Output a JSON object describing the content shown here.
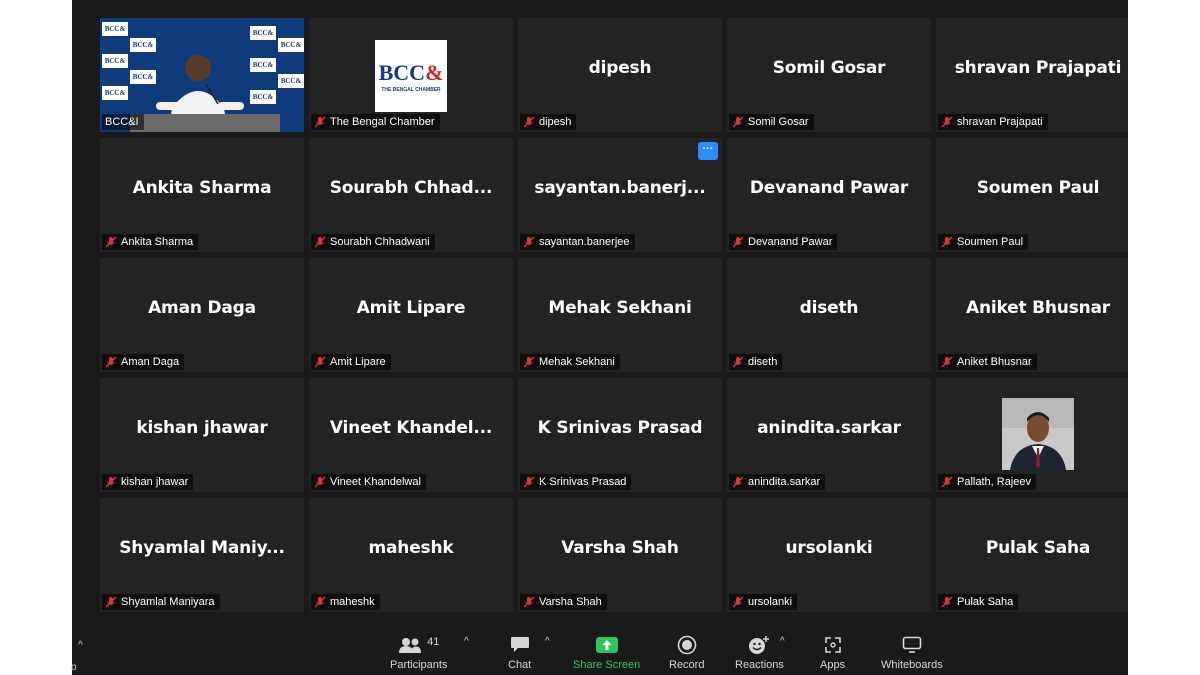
{
  "tiles": [
    {
      "display": "",
      "nameplate": "BCC&I",
      "type": "video"
    },
    {
      "display": "",
      "nameplate": "The Bengal Chamber",
      "type": "logo"
    },
    {
      "display": "dipesh",
      "nameplate": "dipesh"
    },
    {
      "display": "Somil Gosar",
      "nameplate": "Somil Gosar"
    },
    {
      "display": "shravan Prajapati",
      "nameplate": "shravan Prajapati"
    },
    {
      "display": "Ankita Sharma",
      "nameplate": "Ankita Sharma"
    },
    {
      "display": "Sourabh Chhad...",
      "nameplate": "Sourabh Chhadwani"
    },
    {
      "display": "sayantan.banerj...",
      "nameplate": "sayantan.banerjee",
      "more": "···"
    },
    {
      "display": "Devanand Pawar",
      "nameplate": "Devanand Pawar"
    },
    {
      "display": "Soumen Paul",
      "nameplate": "Soumen Paul"
    },
    {
      "display": "Aman Daga",
      "nameplate": "Aman Daga"
    },
    {
      "display": "Amit Lipare",
      "nameplate": "Amit Lipare"
    },
    {
      "display": "Mehak Sekhani",
      "nameplate": "Mehak Sekhani"
    },
    {
      "display": "diseth",
      "nameplate": "diseth"
    },
    {
      "display": "Aniket Bhusnar",
      "nameplate": "Aniket Bhusnar"
    },
    {
      "display": "kishan jhawar",
      "nameplate": "kishan jhawar"
    },
    {
      "display": "Vineet  Khandel...",
      "nameplate": "Vineet Khandelwal"
    },
    {
      "display": "K Srinivas Prasad",
      "nameplate": "K Srinivas Prasad"
    },
    {
      "display": "anindita.sarkar",
      "nameplate": "anindita.sarkar"
    },
    {
      "display": "",
      "nameplate": "Pallath, Rajeev",
      "type": "photo"
    },
    {
      "display": "Shyamlal  Maniy...",
      "nameplate": "Shyamlal Maniyara"
    },
    {
      "display": "maheshk",
      "nameplate": "maheshk"
    },
    {
      "display": "Varsha Shah",
      "nameplate": "Varsha Shah"
    },
    {
      "display": "ursolanki",
      "nameplate": "ursolanki"
    },
    {
      "display": "Pulak Saha",
      "nameplate": "Pulak Saha"
    }
  ],
  "logo": {
    "text": "BCC",
    "amp": "&",
    "sub": "THE BENGAL CHAMBER"
  },
  "video_logo_text": "BCC&",
  "toolbar": {
    "participants_count": "41",
    "participants": "Participants",
    "chat": "Chat",
    "share_screen": "Share Screen",
    "record": "Record",
    "reactions": "Reactions",
    "apps": "Apps",
    "whiteboards": "Whiteboards",
    "caret": "^"
  },
  "edge": {
    "caret": "^",
    "letter": "o"
  },
  "colors": {
    "background": "#1a1a1a",
    "tile": "#232323",
    "active_speaker": "#d2ff3a",
    "share_green": "#31c35a",
    "mute_red": "#e0323c",
    "more_blue": "#2d8cff"
  }
}
